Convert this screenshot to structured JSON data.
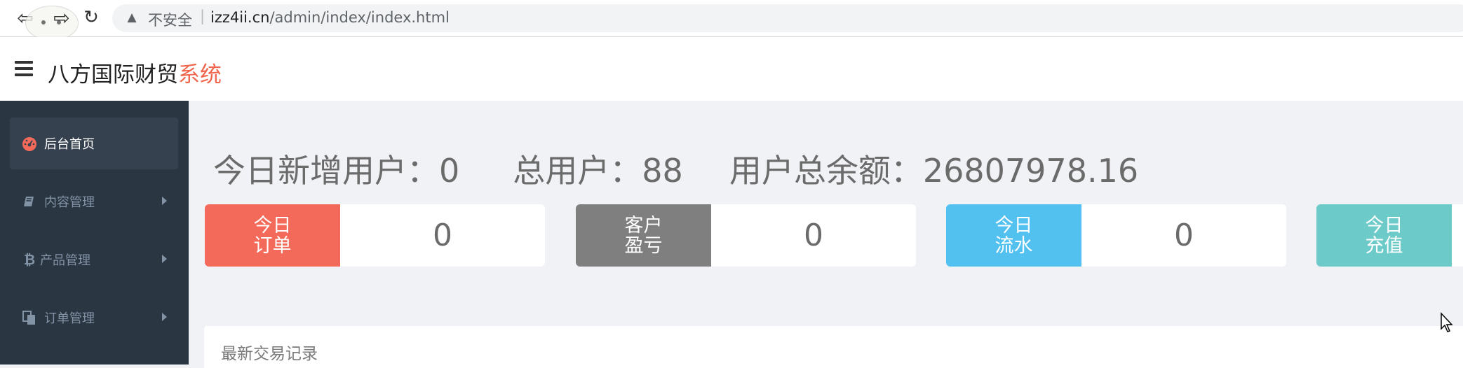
{
  "browser": {
    "security_label": "不安全",
    "url_host": "izz4ii.cn",
    "url_path": "/admin/index/index.html"
  },
  "header": {
    "brand_main": "八方国际财贸",
    "brand_accent": "系统"
  },
  "sidebar": {
    "items": [
      {
        "label": "后台首页",
        "icon": "dashboard-icon",
        "active": true
      },
      {
        "label": "内容管理",
        "icon": "book-icon"
      },
      {
        "label": "产品管理",
        "icon": "bitcoin-icon"
      },
      {
        "label": "订单管理",
        "icon": "copy-icon"
      }
    ]
  },
  "stats": {
    "new_users_label": "今日新增用户：",
    "new_users_value": "0",
    "total_users_label": "总用户：",
    "total_users_value": "88",
    "balance_label": "用户总余额：",
    "balance_value": "26807978.16"
  },
  "cards": [
    {
      "label": "今日\n订单",
      "value": "0",
      "color": "#f36a5a"
    },
    {
      "label": "客户\n盈亏",
      "value": "0",
      "color": "#7f7f7f"
    },
    {
      "label": "今日\n流水",
      "value": "0",
      "color": "#53c1f0"
    },
    {
      "label": "今日\n充值",
      "value": "",
      "color": "#6ccac9"
    }
  ],
  "panel": {
    "title": "最新交易记录"
  },
  "colors": {
    "sidebar_bg": "#2b3643",
    "accent": "#f0664d"
  }
}
